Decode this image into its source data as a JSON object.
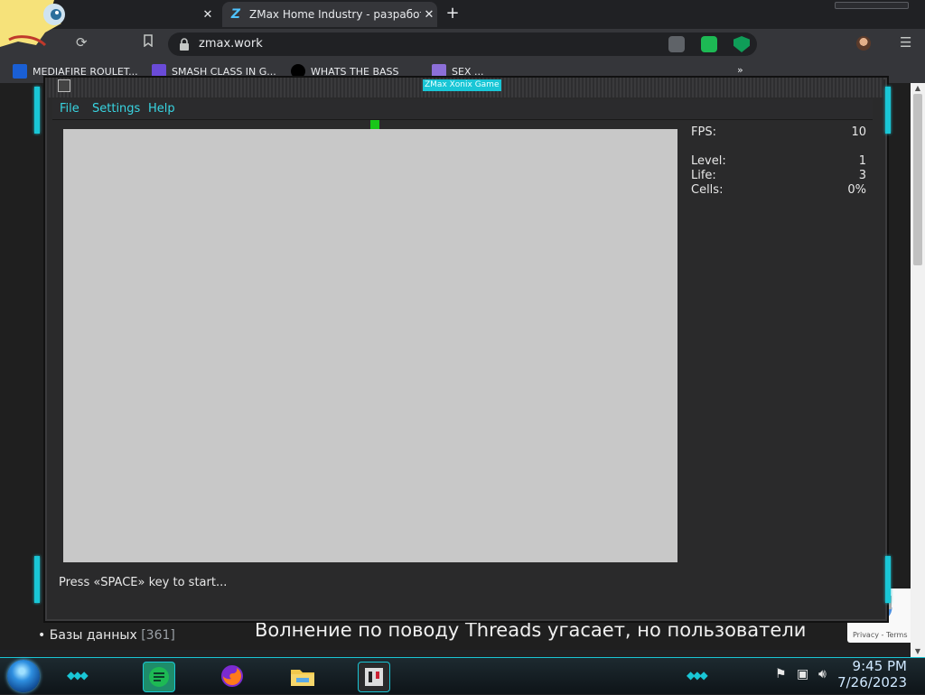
{
  "browser": {
    "tabs": [
      {
        "title": "",
        "active": false
      },
      {
        "title": "ZMax Home Industry - разработка",
        "active": true
      }
    ],
    "new_tab_label": "+",
    "close_label": "✕",
    "url": "zmax.work",
    "bookmarks": [
      {
        "label": "MEDIAFIRE ROULET...",
        "color": "#1a5fd4"
      },
      {
        "label": "SMASH CLASS IN G...",
        "color": "#6a4bd8"
      },
      {
        "label": "WHATS THE BASS",
        "color": "#111111"
      },
      {
        "label": "SEX ...",
        "color": "#8c6fd8"
      }
    ],
    "bookmark_overflow": "»"
  },
  "page": {
    "headline": "Волнение по поводу Threads угасает, но пользователи",
    "list_item": {
      "label": "Базы данных",
      "count": "[361]"
    },
    "recaptcha": "Privacy - Terms"
  },
  "game": {
    "title": "ZMax Xonix Game",
    "menu": [
      "File",
      "Settings",
      "Help"
    ],
    "stats": [
      {
        "label": "FPS:",
        "value": "10"
      },
      {
        "label": "Level:",
        "value": "1"
      },
      {
        "label": "Life:",
        "value": "3"
      },
      {
        "label": "Cells:",
        "value": "0%"
      }
    ],
    "status": "Press «SPACE» key to start...",
    "colors": {
      "field": "#c8c8c8",
      "player": "#19c619",
      "accent": "#19c6d6",
      "menu_text": "#38d5e2"
    }
  },
  "taskbar": {
    "time": "9:45 PM",
    "date": "7/26/2023",
    "apps": [
      "notes-app",
      "firefox",
      "file-explorer",
      "xonix-game"
    ]
  }
}
